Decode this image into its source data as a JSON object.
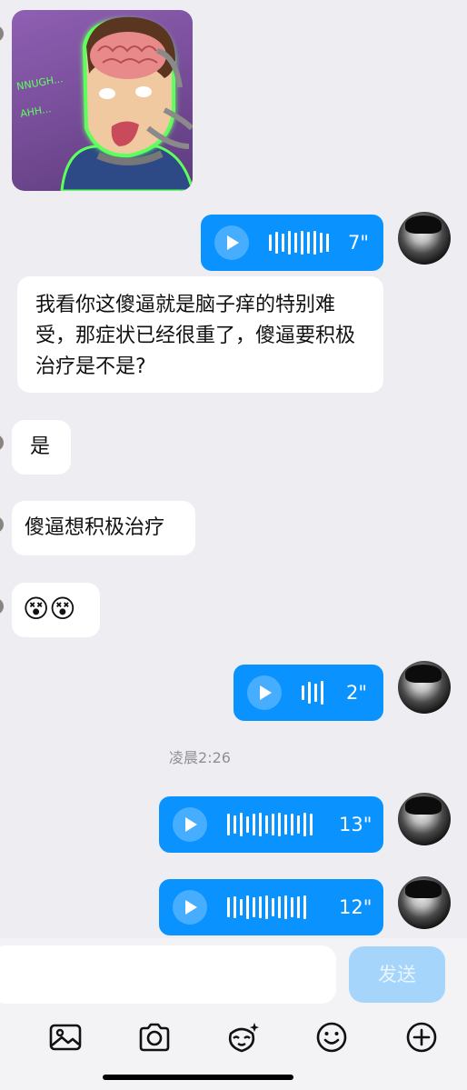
{
  "messages": [
    {
      "type": "sticker",
      "side": "left",
      "sticker_text": [
        "NNUGH...",
        "AHH..."
      ]
    },
    {
      "type": "voice",
      "side": "right",
      "duration": "7\""
    },
    {
      "type": "text",
      "side": "left",
      "text": "我看你这傻逼就是脑子痒的特别难受，那症状已经很重了，傻逼要积极治疗是不是?"
    },
    {
      "type": "text",
      "side": "left",
      "text": "是"
    },
    {
      "type": "text",
      "side": "left",
      "text": "傻逼想积极治疗"
    },
    {
      "type": "emoji",
      "side": "left",
      "text": "😵😵"
    },
    {
      "type": "voice",
      "side": "right",
      "duration": "2\""
    },
    {
      "type": "timestamp",
      "text": "凌晨2:26"
    },
    {
      "type": "voice",
      "side": "right",
      "duration": "13\""
    },
    {
      "type": "voice",
      "side": "right",
      "duration": "12\""
    }
  ],
  "input": {
    "value": "",
    "placeholder": ""
  },
  "send_label": "发送",
  "toolbar": {
    "icons": [
      "image-icon",
      "camera-icon",
      "face-sparkle-icon",
      "emoji-icon",
      "plus-icon"
    ]
  },
  "colors": {
    "background": "#eeeef2",
    "voice_bubble": "#0a93ff",
    "send_button": "#a6d5fb",
    "text_bubble": "#ffffff"
  }
}
